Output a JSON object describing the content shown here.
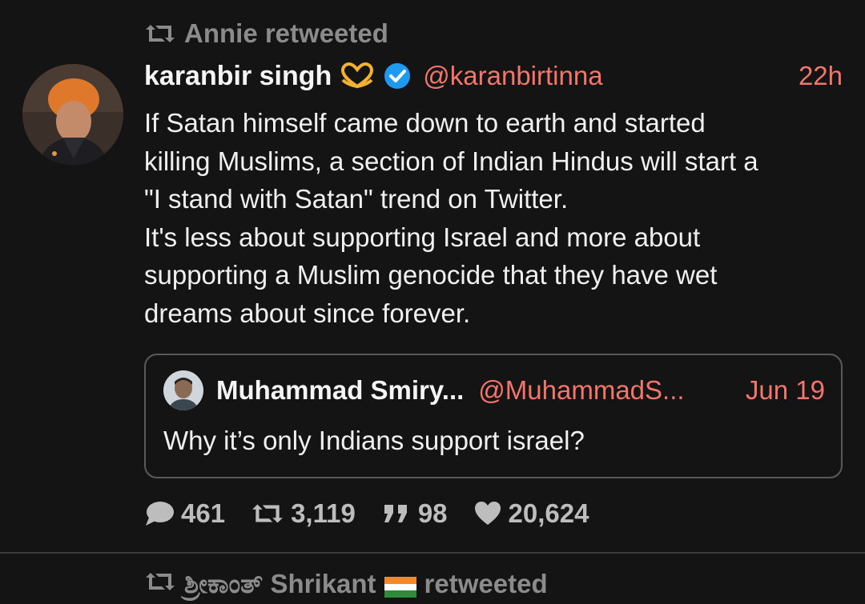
{
  "retweet_context": {
    "text": "Annie retweeted",
    "icon": "retweet-icon"
  },
  "tweet": {
    "author_name": "karanbir singh",
    "author_emoji": "heart-hands-icon",
    "verified": true,
    "handle": "@karanbirtinna",
    "time": "22h",
    "text_lines": [
      "If Satan himself came down to earth and started",
      "killing Muslims, a section of Indian Hindus will start a",
      "\"I stand with Satan\" trend on Twitter.",
      "It's less about supporting Israel and more about",
      "supporting a Muslim genocide that they have wet",
      "dreams about since forever."
    ],
    "quote": {
      "author_name": "Muhammad Smiry...",
      "handle": "@MuhammadS...",
      "time": "Jun 19",
      "text": "Why it’s only Indians support israel?"
    },
    "stats": {
      "replies": "461",
      "retweets": "3,119",
      "quotes": "98",
      "likes": "20,624"
    }
  },
  "next_retweet_context": {
    "prefix": "ಶ್ರೀಕಾಂತ್ Shrikant",
    "suffix": "retweeted"
  },
  "colors": {
    "accent": "#f4756a",
    "background": "#141414",
    "muted": "#8b8b8b",
    "verified": "#1d9bf0"
  }
}
